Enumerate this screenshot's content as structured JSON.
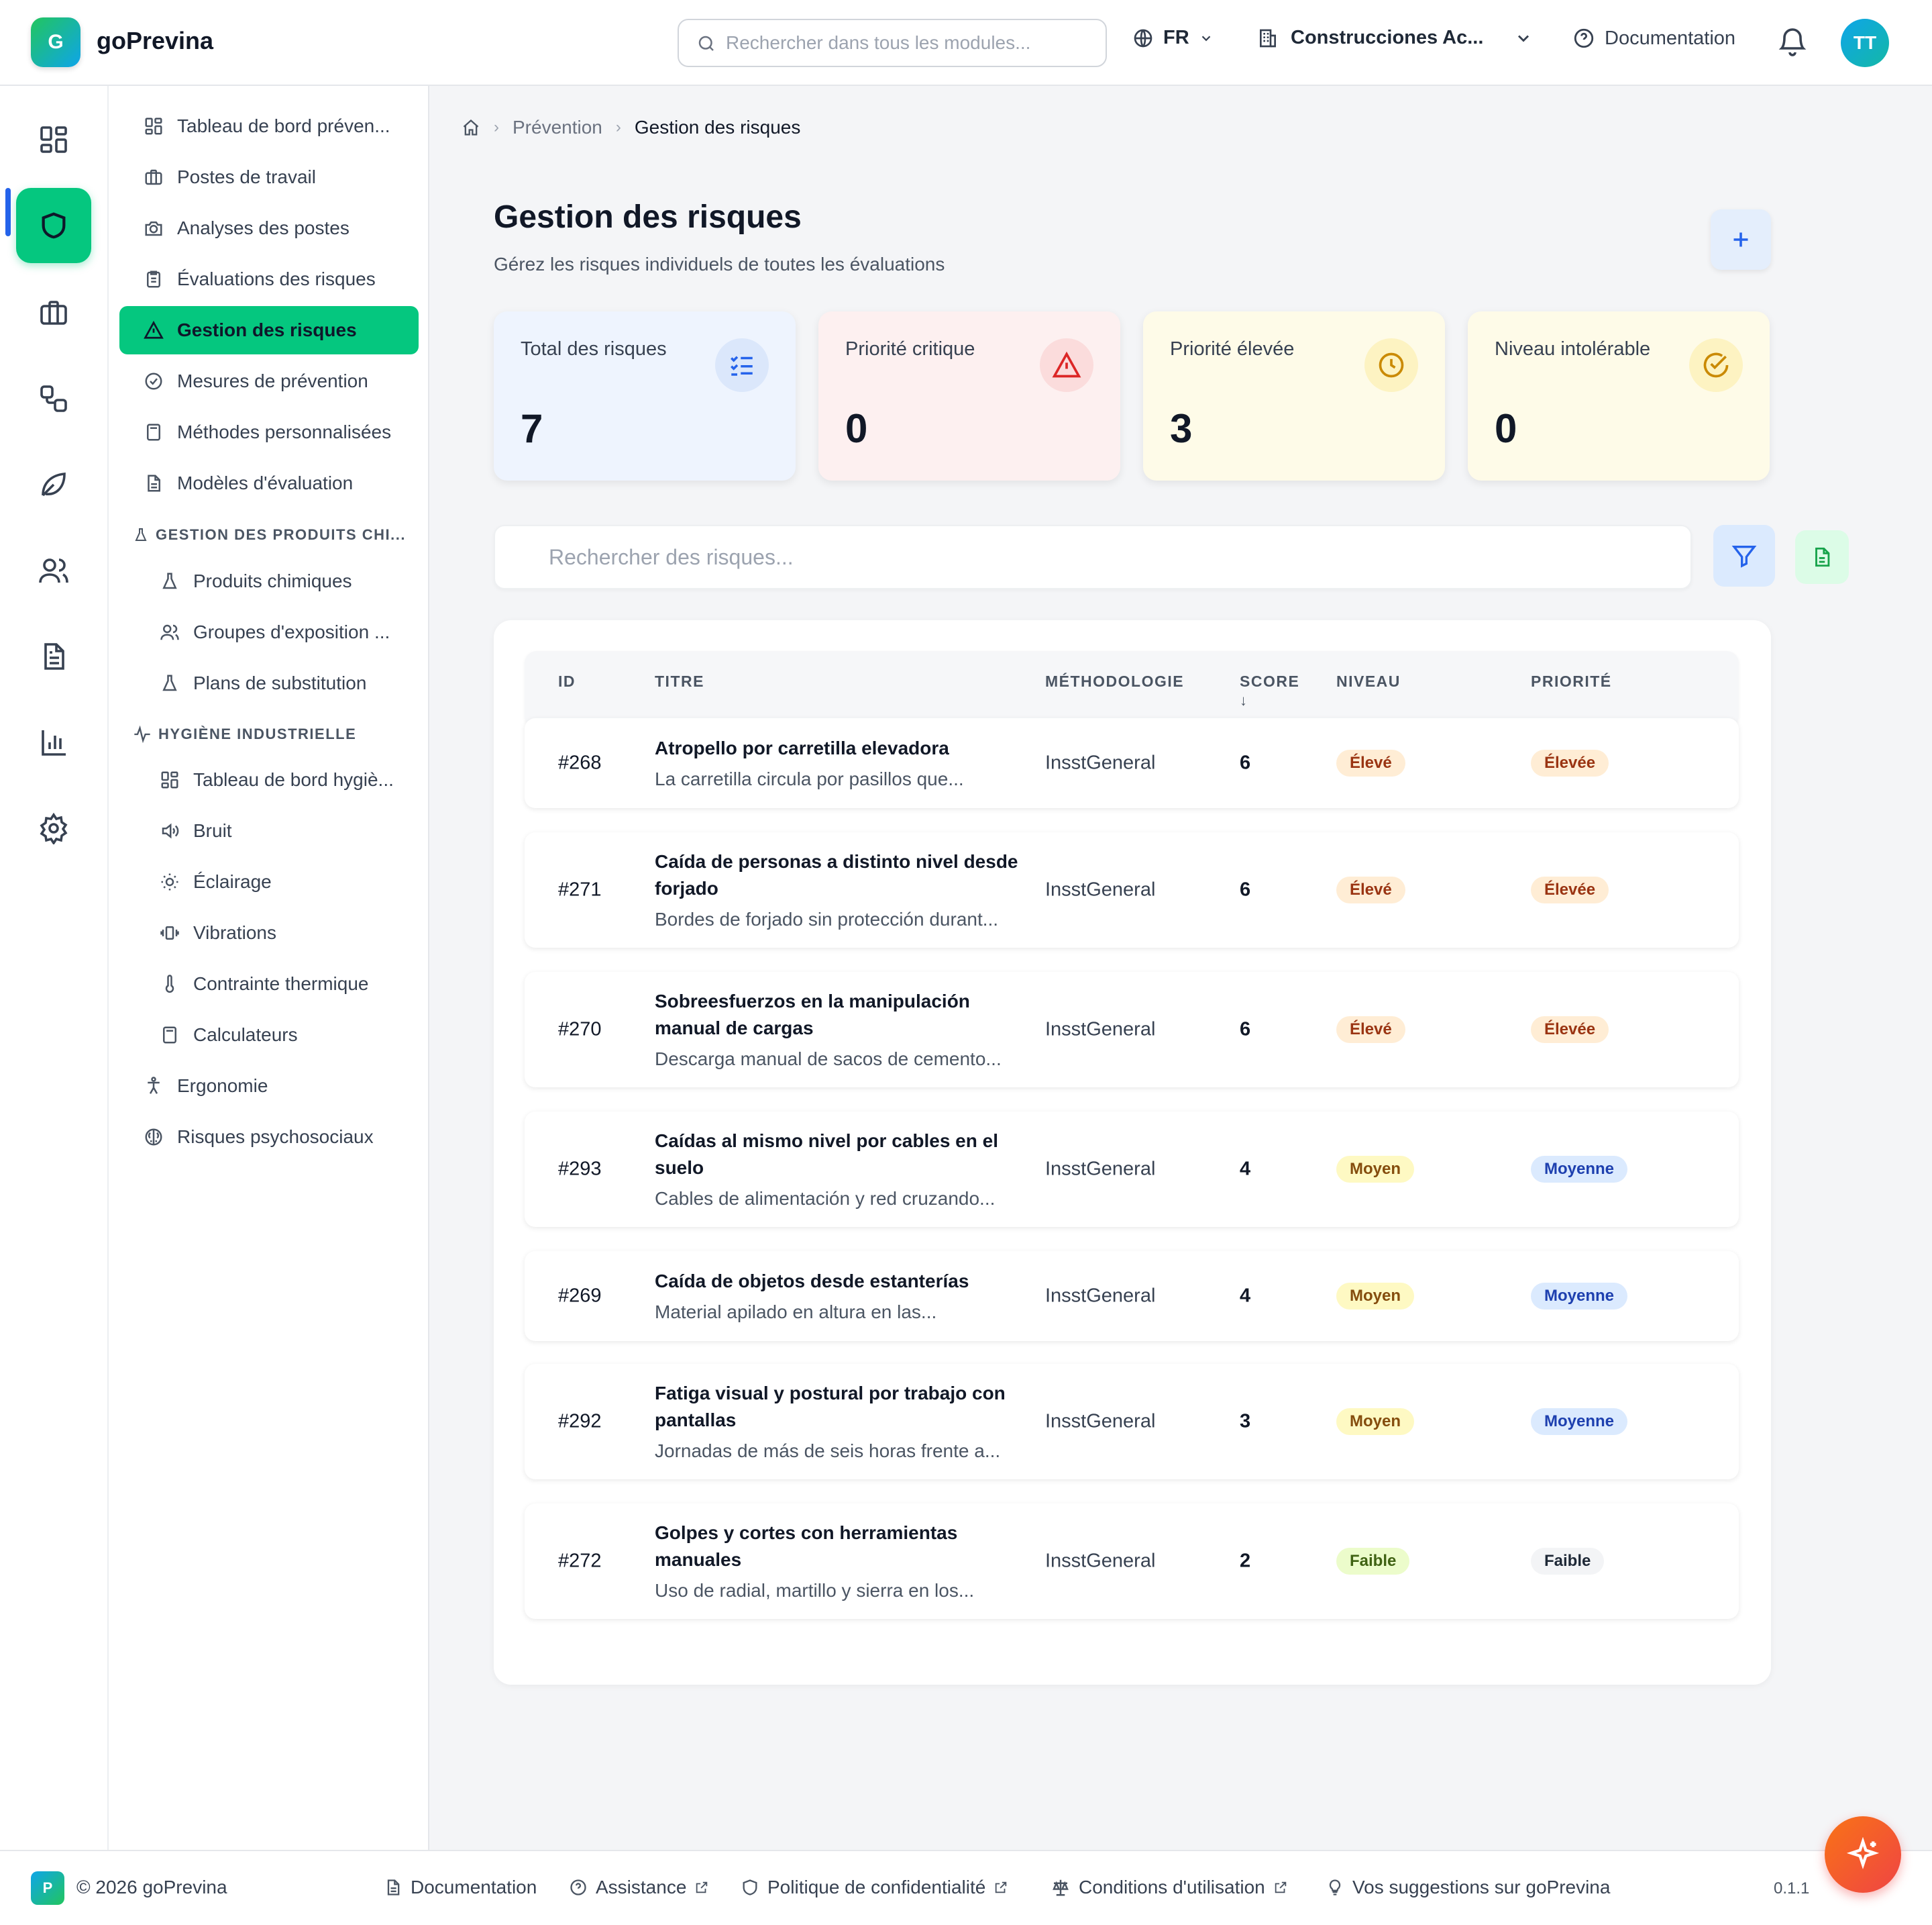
{
  "header": {
    "logo_letter": "G",
    "brand": "goPrevina",
    "search_placeholder": "Rechercher dans tous les modules...",
    "language": "FR",
    "company": "Construcciones Ac...",
    "documentation": "Documentation",
    "avatar_initials": "TT"
  },
  "sidebar": {
    "items": [
      {
        "label": "Tableau de bord préven...",
        "icon": "dashboard-icon"
      },
      {
        "label": "Postes de travail",
        "icon": "briefcase-icon"
      },
      {
        "label": "Analyses des postes",
        "icon": "camera-icon"
      },
      {
        "label": "Évaluations des risques",
        "icon": "clipboard-icon"
      },
      {
        "label": "Gestion des risques",
        "icon": "warning-icon",
        "active": true
      },
      {
        "label": "Mesures de prévention",
        "icon": "check-circle-icon"
      },
      {
        "label": "Méthodes personnalisées",
        "icon": "calculator-icon"
      },
      {
        "label": "Modèles d'évaluation",
        "icon": "file-icon"
      }
    ],
    "chem_header": "GESTION DES PRODUITS CHI...",
    "chem_items": [
      {
        "label": "Produits chimiques",
        "icon": "flask-icon"
      },
      {
        "label": "Groupes d'exposition ...",
        "icon": "users-icon"
      },
      {
        "label": "Plans de substitution",
        "icon": "flask-icon"
      }
    ],
    "hyg_header": "HYGIÈNE INDUSTRIELLE",
    "hyg_items": [
      {
        "label": "Tableau de bord hygiè...",
        "icon": "dashboard-icon"
      },
      {
        "label": "Bruit",
        "icon": "speaker-icon"
      },
      {
        "label": "Éclairage",
        "icon": "sun-icon"
      },
      {
        "label": "Vibrations",
        "icon": "vibration-icon"
      },
      {
        "label": "Contrainte thermique",
        "icon": "thermometer-icon"
      },
      {
        "label": "Calculateurs",
        "icon": "calculator-icon"
      }
    ],
    "bottom_items": [
      {
        "label": "Ergonomie",
        "icon": "person-icon"
      },
      {
        "label": "Risques psychosociaux",
        "icon": "brain-icon"
      }
    ]
  },
  "breadcrumb": {
    "parent": "Prévention",
    "current": "Gestion des risques"
  },
  "page": {
    "title": "Gestion des risques",
    "subtitle": "Gérez les risques individuels de toutes les évaluations"
  },
  "stats": [
    {
      "label": "Total des risques",
      "value": "7",
      "bg": "#eef4fe",
      "icon_bg": "#dbe7fb",
      "color": "#2563eb"
    },
    {
      "label": "Priorité critique",
      "value": "0",
      "bg": "#fdf0f0",
      "icon_bg": "#fbdcdc",
      "color": "#dc2626"
    },
    {
      "label": "Priorité élevée",
      "value": "3",
      "bg": "#fefbe8",
      "icon_bg": "#fdf3c2",
      "color": "#ca8a04"
    },
    {
      "label": "Niveau intolérable",
      "value": "0",
      "bg": "#fefbe8",
      "icon_bg": "#fdf3c2",
      "color": "#ca8a04"
    }
  ],
  "risk_search_placeholder": "Rechercher des risques...",
  "table": {
    "headers": {
      "id": "ID",
      "title": "TITRE",
      "methodology": "MÉTHODOLOGIE",
      "score": "SCORE",
      "sort_arrow": "↓",
      "level": "NIVEAU",
      "priority": "PRIORITÉ"
    },
    "rows": [
      {
        "id": "#268",
        "title": "Atropello por carretilla elevadora",
        "desc": "La carretilla circula por pasillos que...",
        "methodology": "InsstGeneral",
        "score": "6",
        "level": "Élevé",
        "level_style": "eleve",
        "priority": "Élevée",
        "priority_style": "eleve"
      },
      {
        "id": "#271",
        "title": "Caída de personas a distinto nivel desde forjado",
        "desc": "Bordes de forjado sin protección durant...",
        "methodology": "InsstGeneral",
        "score": "6",
        "level": "Élevé",
        "level_style": "eleve",
        "priority": "Élevée",
        "priority_style": "eleve"
      },
      {
        "id": "#270",
        "title": "Sobreesfuerzos en la manipulación manual de cargas",
        "desc": "Descarga manual de sacos de cemento...",
        "methodology": "InsstGeneral",
        "score": "6",
        "level": "Élevé",
        "level_style": "eleve",
        "priority": "Élevée",
        "priority_style": "eleve"
      },
      {
        "id": "#293",
        "title": "Caídas al mismo nivel por cables en el suelo",
        "desc": "Cables de alimentación y red cruzando...",
        "methodology": "InsstGeneral",
        "score": "4",
        "level": "Moyen",
        "level_style": "moyen",
        "priority": "Moyenne",
        "priority_style": "moyenne"
      },
      {
        "id": "#269",
        "title": "Caída de objetos desde estanterías",
        "desc": "Material apilado en altura en las...",
        "methodology": "InsstGeneral",
        "score": "4",
        "level": "Moyen",
        "level_style": "moyen",
        "priority": "Moyenne",
        "priority_style": "moyenne"
      },
      {
        "id": "#292",
        "title": "Fatiga visual y postural por trabajo con pantallas",
        "desc": "Jornadas de más de seis horas frente a...",
        "methodology": "InsstGeneral",
        "score": "3",
        "level": "Moyen",
        "level_style": "moyen",
        "priority": "Moyenne",
        "priority_style": "moyenne"
      },
      {
        "id": "#272",
        "title": "Golpes y cortes con herramientas manuales",
        "desc": "Uso de radial, martillo y sierra en los...",
        "methodology": "InsstGeneral",
        "score": "2",
        "level": "Faible",
        "level_style": "faible-l",
        "priority": "Faible",
        "priority_style": "faible-p"
      }
    ]
  },
  "footer": {
    "logo_letter": "P",
    "copyright": "© 2026 goPrevina",
    "documentation": "Documentation",
    "assistance": "Assistance",
    "privacy": "Politique de confidentialité",
    "terms": "Conditions d'utilisation",
    "suggestions": "Vos suggestions sur goPrevina",
    "version": "0.1.1"
  }
}
